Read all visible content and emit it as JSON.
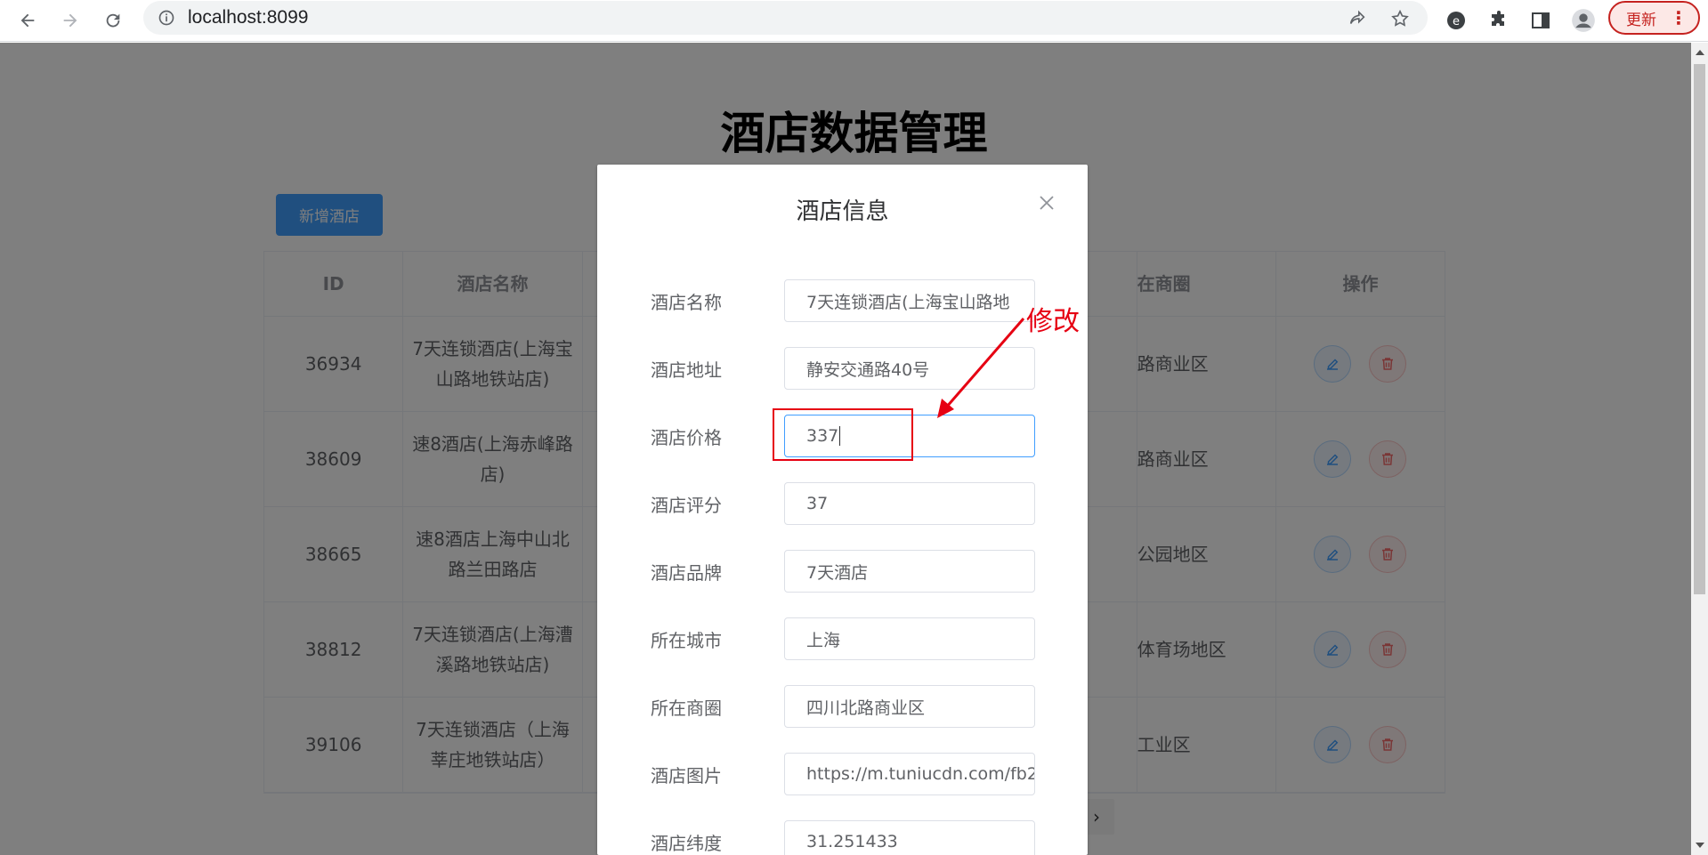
{
  "browser": {
    "url": "localhost:8099",
    "update_label": "更新",
    "update_menu": "⋮"
  },
  "page": {
    "title": "酒店数据管理",
    "add_button": "新增酒店",
    "table": {
      "headers": {
        "id": "ID",
        "name": "酒店名称",
        "area": "在商圈",
        "operations": "操作"
      },
      "rows": [
        {
          "id": "36934",
          "name": "7天连锁酒店(上海宝山路地铁站店)",
          "area": "路商业区"
        },
        {
          "id": "38609",
          "name": "速8酒店(上海赤峰路店)",
          "area": "路商业区"
        },
        {
          "id": "38665",
          "name": "速8酒店上海中山北路兰田路店",
          "area": "公园地区"
        },
        {
          "id": "38812",
          "name": "7天连锁酒店(上海漕溪路地铁站店)",
          "area": "体育场地区"
        },
        {
          "id": "39106",
          "name": "7天连锁酒店（上海莘庄地铁站店）",
          "area": "工业区"
        }
      ],
      "rows_visible_name": [
        [
          "7天连锁酒店(上海宝",
          "山路地铁站店)"
        ],
        [
          "速8酒店(上海赤峰路",
          "店)"
        ],
        [
          "速8酒店上海中山北",
          "路兰田路店"
        ],
        [
          "7天连锁酒店(上海漕",
          "溪路地铁站店)"
        ],
        [
          "7天连锁酒店（上海",
          "莘庄地铁站店）"
        ]
      ]
    },
    "pager_next": "›"
  },
  "dialog": {
    "title": "酒店信息",
    "fields": [
      {
        "label": "酒店名称",
        "value": "7天连锁酒店(上海宝山路地"
      },
      {
        "label": "酒店地址",
        "value": "静安交通路40号"
      },
      {
        "label": "酒店价格",
        "value": "337"
      },
      {
        "label": "酒店评分",
        "value": "37"
      },
      {
        "label": "酒店品牌",
        "value": "7天酒店"
      },
      {
        "label": "所在城市",
        "value": "上海"
      },
      {
        "label": "所在商圈",
        "value": "四川北路商业区"
      },
      {
        "label": "酒店图片",
        "value": "https://m.tuniucdn.com/fb2/"
      },
      {
        "label": "酒店纬度",
        "value": "31.251433"
      }
    ]
  },
  "annotation": {
    "text": "修改",
    "color": "#e60012"
  },
  "colors": {
    "primary": "#409eff",
    "danger": "#f56c6c",
    "overlay": "rgba(0,0,0,0.5)"
  }
}
